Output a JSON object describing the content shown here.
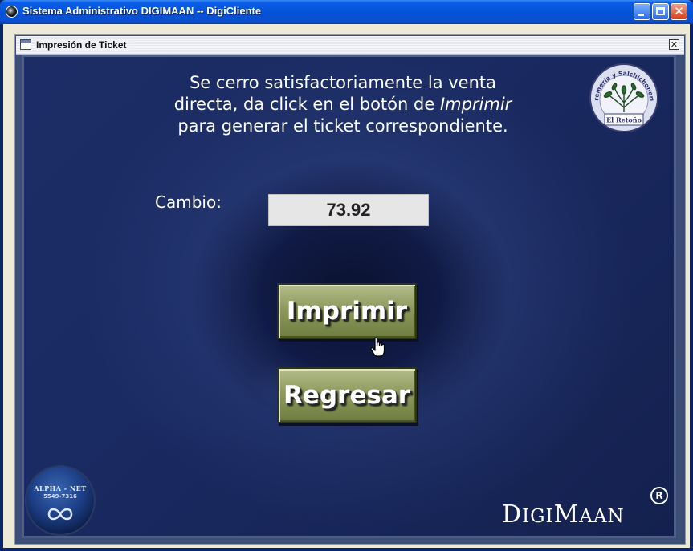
{
  "window": {
    "title": "Sistema Administrativo DIGIMAAN -- DigiCliente",
    "buttons": [
      "minimize",
      "maximize",
      "close"
    ]
  },
  "internal_frame": {
    "title": "Impresión de Ticket",
    "close_glyph": "☒"
  },
  "message": {
    "line1": "Se cerro satisfactoriamente la venta",
    "line2_prefix": "directa, da click en el botón de",
    "line2_emphasis": "Imprimir",
    "line3": "para generar el ticket correspondiente."
  },
  "change": {
    "label": "Cambio:",
    "value": "73.92"
  },
  "buttons": {
    "print": "Imprimir",
    "back": "Regresar"
  },
  "seal_logo": {
    "top_text": "Cremeria y Salchichoneria",
    "bottom_text": "El Retoño"
  },
  "alpha_logo": {
    "name": "ALPHA - NET",
    "phone": "5549-7316"
  },
  "brand": {
    "name_big1": "D",
    "name_small1": "IGI",
    "name_big2": "M",
    "name_small2": "AAN",
    "registered": "R"
  },
  "colors": {
    "title_bar": "#0553d8",
    "content_background": "#1a2a62",
    "button_face": "#8d9a5c",
    "field_background": "#e6e6e6"
  },
  "icons": {
    "app": "app-icon",
    "frame": "window-icon",
    "cursor": "hand-pointer-icon"
  }
}
